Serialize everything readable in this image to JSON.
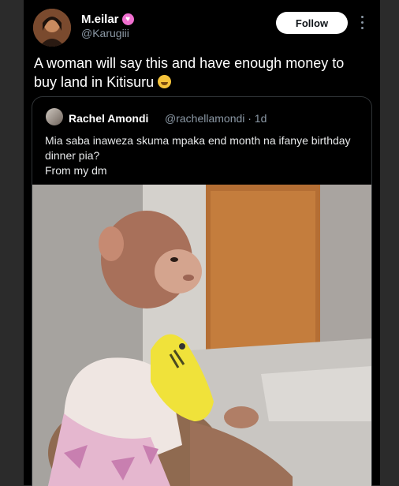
{
  "author": {
    "name": "M.eilar",
    "handle": "@Karugiii"
  },
  "follow_label": "Follow",
  "tweet_text": "A woman will say this and have enough money to buy land in Kitisuru",
  "quote": {
    "name": "Rachel Amondi",
    "handle_time": "@rachellamondi · 1d",
    "lines": [
      "Mia saba inaweza  skuma mpaka end month na ifanye birthday",
      "dinner pia?",
      "From my dm"
    ]
  },
  "icons": [
    "heart-icon",
    "more-icon",
    "grinning-emoji-icon"
  ]
}
